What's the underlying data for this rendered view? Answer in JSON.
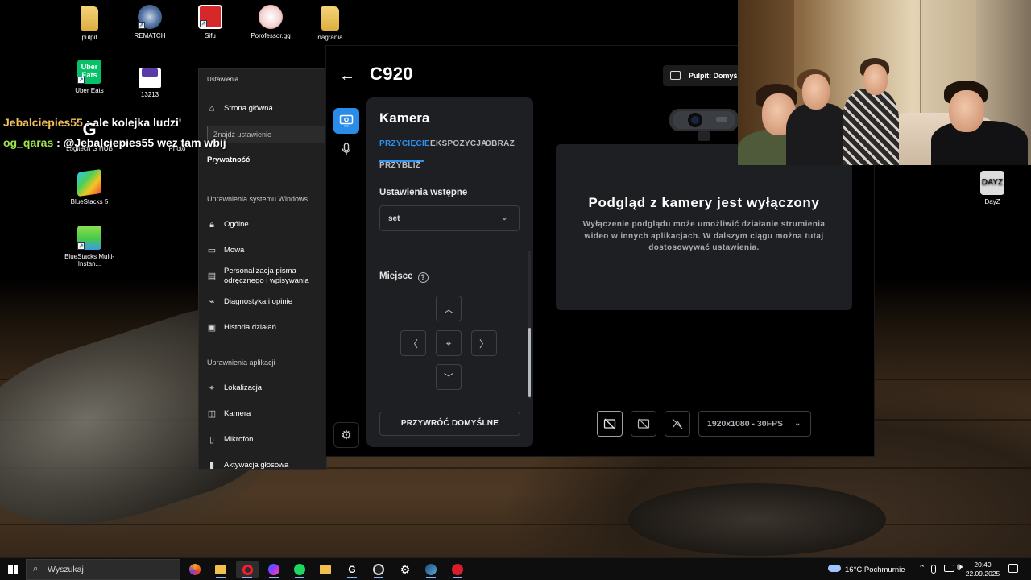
{
  "desktop": {
    "icons": [
      {
        "label": "pulpit",
        "icon": "folder-icon"
      },
      {
        "label": "REMATCH",
        "icon": "rematch-icon"
      },
      {
        "label": "Sifu",
        "icon": "sifu-icon"
      },
      {
        "label": "Porofessor.gg",
        "icon": "porofessor-icon"
      },
      {
        "label": "nagrania",
        "icon": "folder-icon"
      },
      {
        "label": "Uber Eats",
        "icon": "uber-eats-icon"
      },
      {
        "label": "13213",
        "icon": "file-icon"
      },
      {
        "label": "Logitech G HUB",
        "icon": "logitech-icon"
      },
      {
        "label": "Photo",
        "icon": "photo-icon"
      },
      {
        "label": "BlueStacks 5",
        "icon": "bluestacks-icon"
      },
      {
        "label": "BlueStacks Multi-Instan...",
        "icon": "bluestacks-multi-icon"
      },
      {
        "label": "DayZ",
        "icon": "dayz-icon"
      }
    ],
    "uber_logo_text": "Uber Eats",
    "dayz_logo_text": "DAYZ"
  },
  "chat": {
    "messages": [
      {
        "user": "Jebalciepies55",
        "text": ": ale kolejka ludzi'"
      },
      {
        "user": "og_qaras",
        "text": ": @Jebalciepies55 wez tam wbij"
      }
    ]
  },
  "settings_window": {
    "title": "Ustawienia",
    "home": "Strona główna",
    "search_placeholder": "Znajdź ustawienie",
    "privacy": "Prywatność",
    "section_windows": "Uprawnienia systemu Windows",
    "windows_items": [
      {
        "label": "Ogólne",
        "icon": "lock-icon"
      },
      {
        "label": "Mowa",
        "icon": "speech-icon"
      },
      {
        "label": "Personalizacja pisma odręcznego i wpisywania",
        "icon": "handwriting-icon"
      },
      {
        "label": "Diagnostyka i opinie",
        "icon": "diagnostics-icon"
      },
      {
        "label": "Historia działań",
        "icon": "history-icon"
      }
    ],
    "section_apps": "Uprawnienia aplikacji",
    "app_items": [
      {
        "label": "Lokalizacja",
        "icon": "location-icon"
      },
      {
        "label": "Kamera",
        "icon": "camera-icon"
      },
      {
        "label": "Mikrofon",
        "icon": "microphone-icon"
      },
      {
        "label": "Aktywacja głosowa",
        "icon": "voice-activation-icon"
      }
    ]
  },
  "ghub": {
    "device_title": "C920",
    "profile_label": "Pulpit: Domyślny",
    "panel_title": "Kamera",
    "tabs": [
      {
        "label": "PRZYCIĘCIE",
        "active": true
      },
      {
        "label": "EKSPOZYCJA",
        "active": false
      },
      {
        "label": "OBRAZ",
        "active": false
      },
      {
        "label": "PRZYBLIŻ",
        "active": false
      }
    ],
    "presets_label": "Ustawienia wstępne",
    "preset_value": "set",
    "position_label": "Miejsce",
    "help_glyph": "?",
    "reset_label": "PRZYWRÓĆ DOMYŚLNE",
    "preview_title": "Podgląd z kamery jest wyłączony",
    "preview_desc": "Wyłączenie podglądu może umożliwić działanie strumienia wideo w innych aplikacjach. W dalszym ciągu można tutaj dostosowywać ustawienia.",
    "resolution": "1920x1080 - 30FPS",
    "accent_color": "#2d93f0",
    "glyphs": {
      "back": "←",
      "up": "︿",
      "down": "﹀",
      "left": "〈",
      "right": "〉",
      "center": "⌖",
      "chevron": "⌄",
      "gear": "⚙",
      "mic": "🎙"
    }
  },
  "taskbar": {
    "search_placeholder": "Wyszukaj",
    "search_glyph": "⌕",
    "weather": "16°C  Pochmurnie",
    "time": "20:40",
    "date": "22.09.2025",
    "tray_chevron": "⌃"
  }
}
